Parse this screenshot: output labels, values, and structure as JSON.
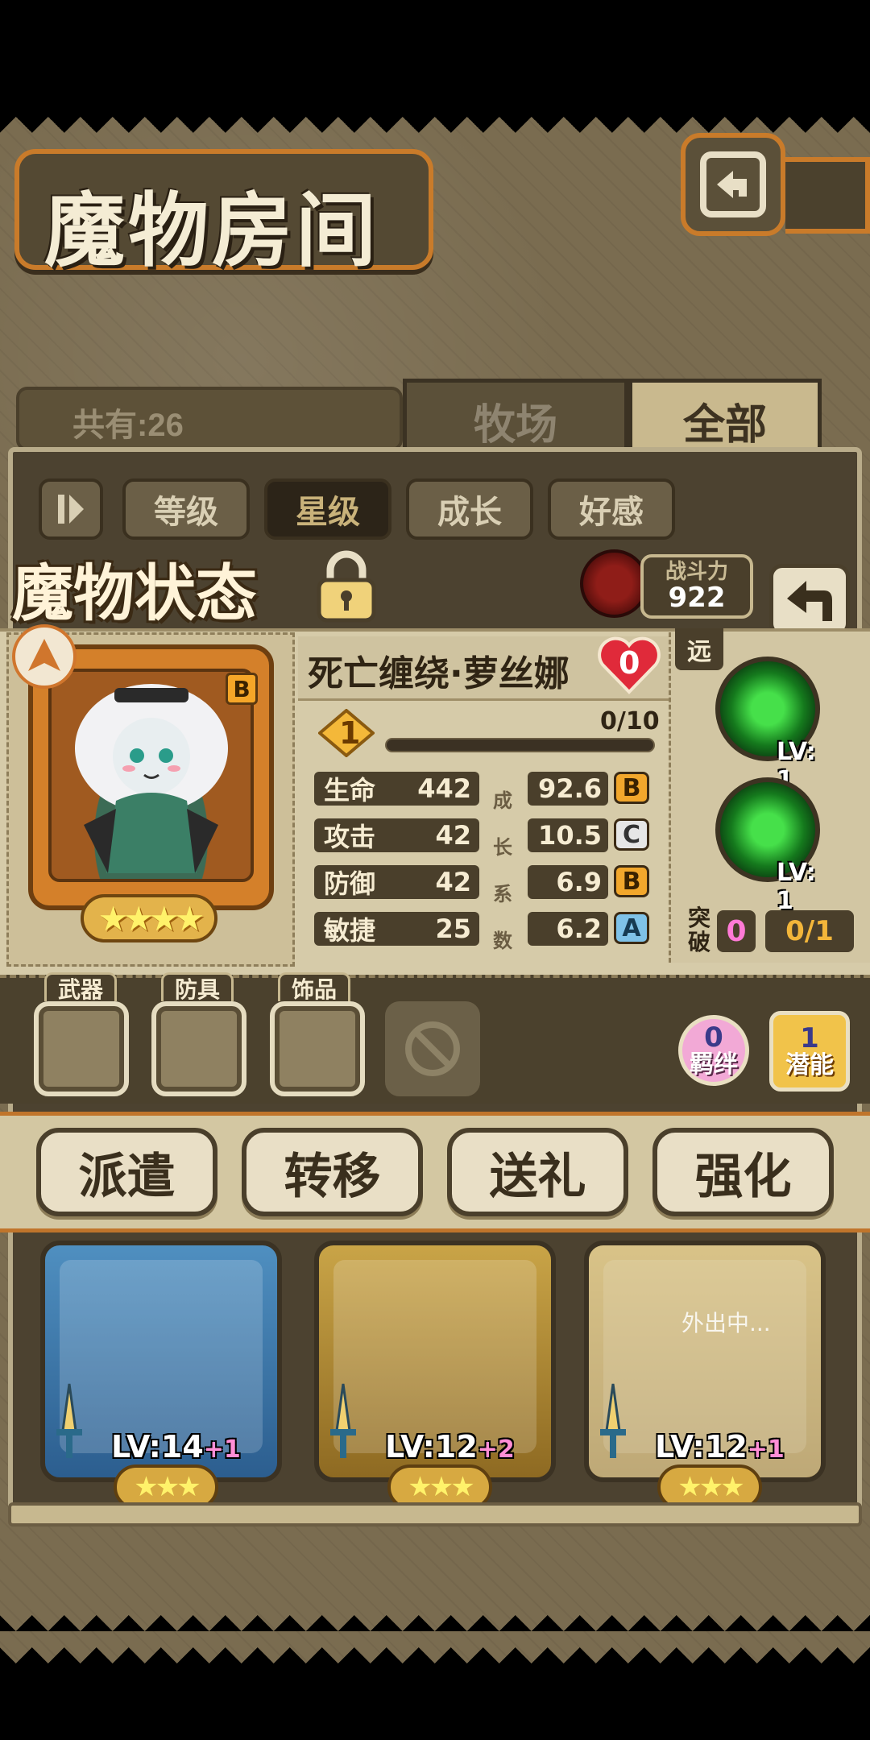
{
  "header": {
    "title": "魔物房间"
  },
  "owned": {
    "label": "共有:26"
  },
  "tabs": [
    {
      "label": "牧场",
      "active": false
    },
    {
      "label": "全部",
      "active": true
    }
  ],
  "sort_filters": [
    {
      "label": "等级",
      "active": false
    },
    {
      "label": "星级",
      "active": true
    },
    {
      "label": "成长",
      "active": false
    },
    {
      "label": "好感",
      "active": false
    }
  ],
  "status": {
    "title": "魔物状态",
    "power_label": "战斗力",
    "power_value": "922",
    "monster_name": "死亡缠绕·萝丝娜",
    "heart_value": "0",
    "grade": "B",
    "level": "1",
    "xp_text": "0/10",
    "xp_fraction": 0.0,
    "star_count": 4,
    "stars_text": "★★★★",
    "range_tag": "远",
    "growth_vertical": [
      "成",
      "长",
      "系",
      "数"
    ],
    "stats": [
      {
        "label": "生命",
        "value": "442",
        "growth": "92.6",
        "grade": "B"
      },
      {
        "label": "攻击",
        "value": "42",
        "growth": "10.5",
        "grade": "C"
      },
      {
        "label": "防御",
        "value": "42",
        "growth": "6.9",
        "grade": "B"
      },
      {
        "label": "敏捷",
        "value": "25",
        "growth": "6.2",
        "grade": "A"
      }
    ],
    "skills": [
      {
        "level": "LV: 1"
      },
      {
        "level": "LV: 1"
      }
    ],
    "breakthrough_label": "突破",
    "breakthrough_count": "0",
    "breakthrough_fraction": "0/1"
  },
  "equipment": {
    "slots": [
      {
        "label": "武器"
      },
      {
        "label": "防具"
      },
      {
        "label": "饰品"
      }
    ],
    "bond_value": "0",
    "bond_label": "羁绊",
    "potential_value": "1",
    "potential_label": "潜能"
  },
  "actions": [
    {
      "label": "派遣"
    },
    {
      "label": "转移"
    },
    {
      "label": "送礼"
    },
    {
      "label": "强化"
    }
  ],
  "cards": [
    {
      "lv": "LV:14",
      "plus": "+1",
      "stars": "★★★",
      "frame": "blue"
    },
    {
      "lv": "LV:12",
      "plus": "+2",
      "stars": "★★★",
      "frame": "gold"
    },
    {
      "lv": "LV:12",
      "plus": "+1",
      "stars": "★★★",
      "frame": "gold",
      "status": "外出中..."
    }
  ],
  "colors": {
    "accent_orange": "#c97b2a",
    "panel_dark": "#4a3f2b",
    "parchment": "#d6cba9",
    "grade_B": "#f2a72c",
    "grade_C": "#e6e6e6",
    "grade_A": "#7fc2e8"
  }
}
